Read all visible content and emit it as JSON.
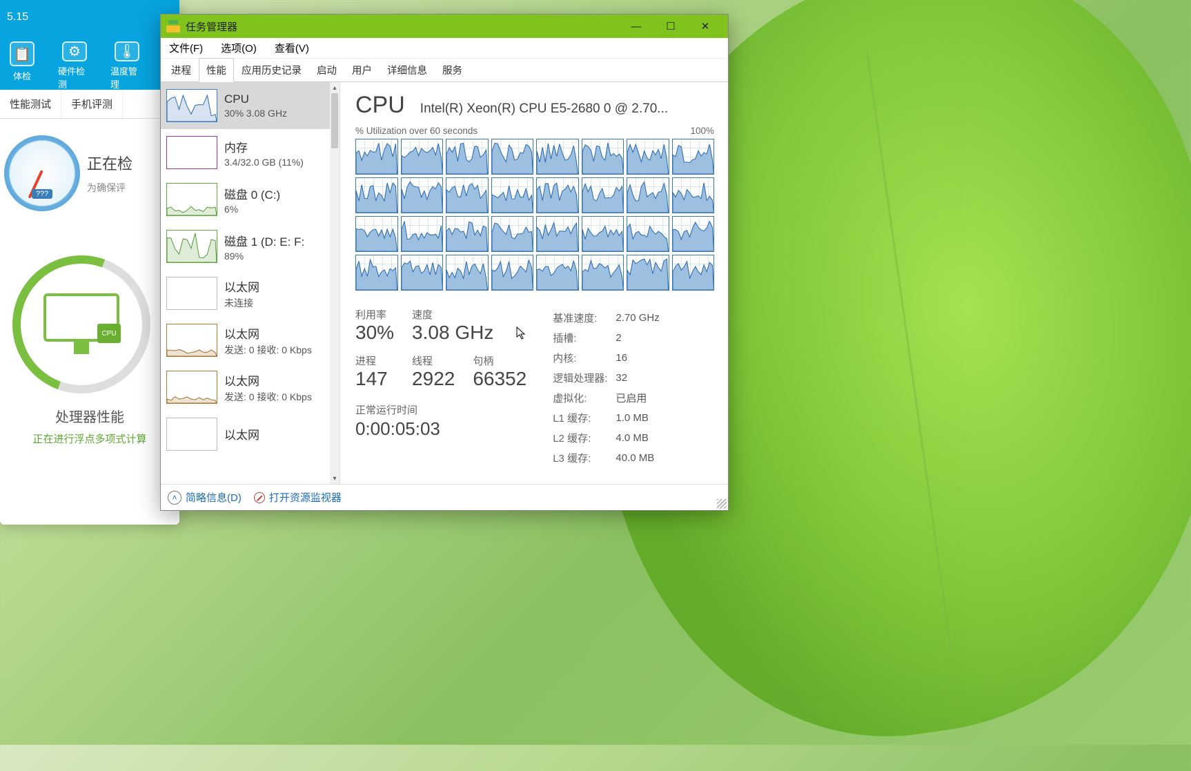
{
  "bg_app": {
    "version": "5.15",
    "tools": [
      {
        "icon": "📋",
        "label": "体检"
      },
      {
        "icon": "⚙",
        "label": "硬件检测"
      },
      {
        "icon": "🌡",
        "label": "温度管理"
      }
    ],
    "tabs": [
      "性能测试",
      "手机评测"
    ],
    "gauge_label": "???",
    "heading": "正在检",
    "sub": "为确保评",
    "cpu": {
      "label": "处理器性能",
      "status": "正在进行浮点多项式计算",
      "chip": "CPU"
    }
  },
  "tm": {
    "title": "任务管理器",
    "menu": [
      "文件(F)",
      "选项(O)",
      "查看(V)"
    ],
    "tabs": [
      "进程",
      "性能",
      "应用历史记录",
      "启动",
      "用户",
      "详细信息",
      "服务"
    ],
    "active_tab": "性能",
    "sidebar": [
      {
        "kind": "cpu",
        "title": "CPU",
        "sub": "30% 3.08 GHz",
        "selected": true
      },
      {
        "kind": "mem",
        "title": "内存",
        "sub": "3.4/32.0 GB (11%)"
      },
      {
        "kind": "disk",
        "title": "磁盘 0 (C:)",
        "sub": "6%"
      },
      {
        "kind": "disk",
        "title": "磁盘 1 (D: E: F:",
        "sub": "89%"
      },
      {
        "kind": "empty",
        "title": "以太网",
        "sub": "未连接"
      },
      {
        "kind": "eth",
        "title": "以太网",
        "sub": "发送: 0 接收: 0 Kbps"
      },
      {
        "kind": "eth",
        "title": "以太网",
        "sub": "发送: 0 接收: 0 Kbps"
      },
      {
        "kind": "empty",
        "title": "以太网",
        "sub": ""
      }
    ],
    "detail": {
      "big": "CPU",
      "name": "Intel(R) Xeon(R) CPU E5-2680 0 @ 2.70...",
      "over": "% Utilization over 60 seconds",
      "pct": "100%",
      "cores": 32,
      "stats": {
        "util_l": "利用率",
        "util_v": "30%",
        "speed_l": "速度",
        "speed_v": "3.08 GHz",
        "proc_l": "进程",
        "proc_v": "147",
        "thr_l": "线程",
        "thr_v": "2922",
        "hnd_l": "句柄",
        "hnd_v": "66352",
        "up_l": "正常运行时间",
        "up_v": "0:00:05:03"
      },
      "right": [
        [
          "基准速度:",
          "2.70 GHz"
        ],
        [
          "插槽:",
          "2"
        ],
        [
          "内核:",
          "16"
        ],
        [
          "逻辑处理器:",
          "32"
        ],
        [
          "虚拟化:",
          "已启用"
        ],
        [
          "L1 缓存:",
          "1.0 MB"
        ],
        [
          "L2 缓存:",
          "4.0 MB"
        ],
        [
          "L3 缓存:",
          "40.0 MB"
        ]
      ]
    },
    "footer": {
      "less": "简略信息(D)",
      "monitor": "打开资源监视器"
    }
  }
}
